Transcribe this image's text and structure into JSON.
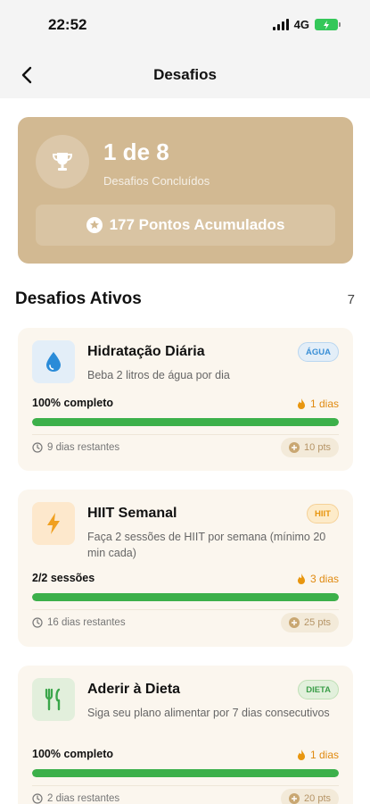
{
  "status_bar": {
    "time": "22:52",
    "network": "4G",
    "battery_color": "#34c759"
  },
  "nav": {
    "back_icon": "chevron-left-icon",
    "title": "Desafios"
  },
  "summary": {
    "accent_color": "#d2b992",
    "icon": "trophy-icon",
    "count": "1 de 8",
    "subtitle": "Desafios Concluídos",
    "points_icon": "star-circle-icon",
    "points": "177 Pontos Acumulados"
  },
  "section": {
    "title": "Desafios Ativos",
    "count": "7"
  },
  "challenges": [
    {
      "title": "Hidratação Diária",
      "description": "Beba 2 litros de água por dia",
      "icon": "water-drop-icon",
      "icon_color": "#2a8bd8",
      "icon_bg": "#e3eef8",
      "tag": "ÁGUA",
      "tag_color": "#3a8fd6",
      "tag_bg": "#e3eef8",
      "progress_label": "100% completo",
      "progress": 1.0,
      "streak": "1 dias",
      "remaining": "9 dias restantes",
      "points": "10 pts"
    },
    {
      "title": "HIIT Semanal",
      "description": "Faça 2 sessões de HIIT por semana (mínimo 20 min cada)",
      "icon": "lightning-bolt-icon",
      "icon_color": "#f0a020",
      "icon_bg": "#fde8cc",
      "tag": "HIIT",
      "tag_color": "#e8960f",
      "tag_bg": "#fdebc9",
      "progress_label": "2/2 sessões",
      "progress": 1.0,
      "streak": "3 dias",
      "remaining": "16 dias restantes",
      "points": "25 pts"
    },
    {
      "title": "Aderir à Dieta",
      "description": "Siga seu plano alimentar por 7 dias consecutivos",
      "icon": "fork-knife-icon",
      "icon_color": "#3aa64a",
      "icon_bg": "#e2efdc",
      "tag": "DIETA",
      "tag_color": "#3c9e4a",
      "tag_bg": "#e2f0dc",
      "progress_label": "100% completo",
      "progress": 1.0,
      "streak": "1 dias",
      "remaining": "2 dias restantes",
      "points": "20 pts"
    }
  ]
}
